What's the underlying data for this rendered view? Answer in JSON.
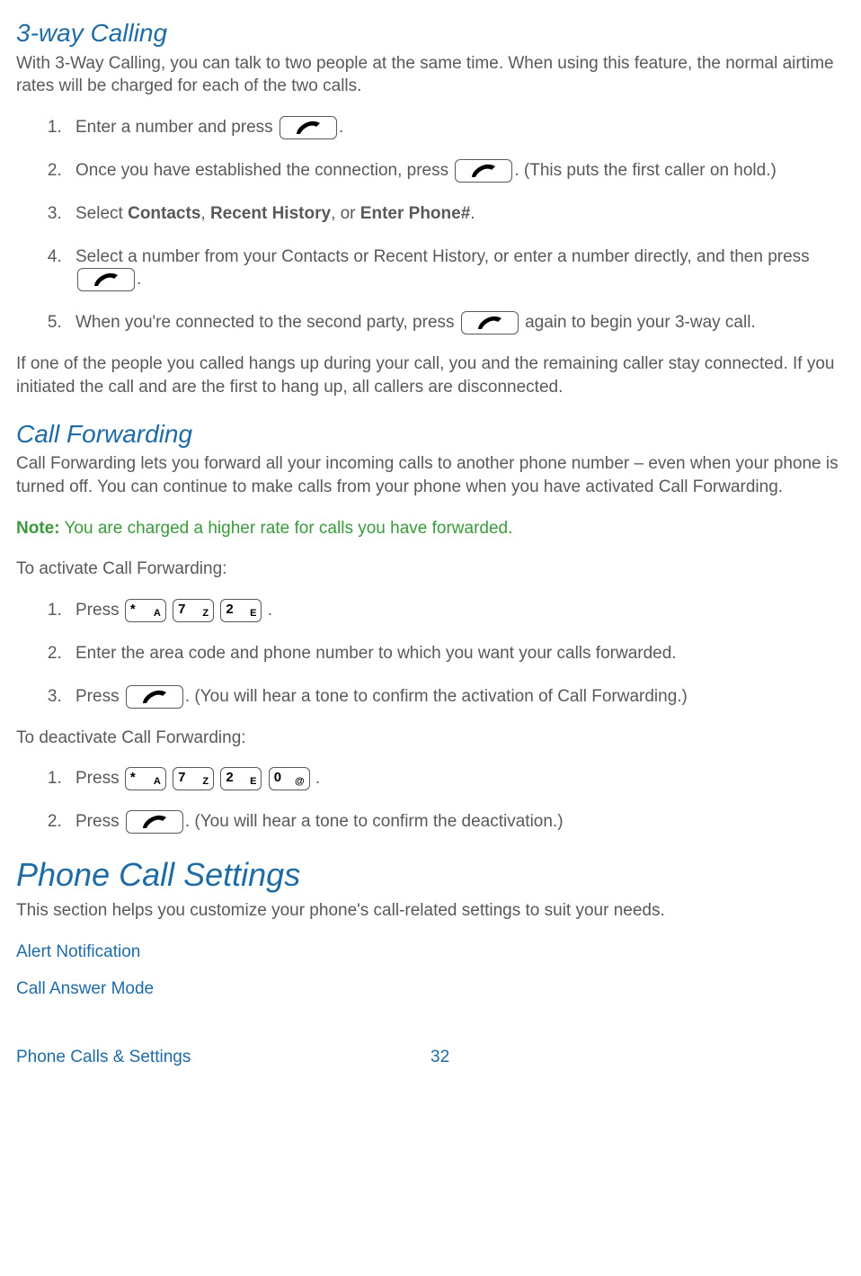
{
  "section1": {
    "title": "3-way Calling",
    "intro": "With 3-Way Calling, you can talk to two people at the same time. When using this feature, the normal airtime rates will be charged for each of the two calls.",
    "step1_a": "Enter a number and press ",
    "step1_b": ".",
    "step2_a": "Once you have established the connection, press ",
    "step2_b": ". (This puts the first caller on hold.)",
    "step3_a": "Select ",
    "step3_contacts": "Contacts",
    "step3_sep1": ", ",
    "step3_recent": "Recent History",
    "step3_sep2": ", or ",
    "step3_enter": "Enter Phone#",
    "step3_end": ".",
    "step4_a": "Select a number from your Contacts or Recent History, or enter a number directly, and then press ",
    "step4_b": ".",
    "step5_a": "When you're connected to the second party, press ",
    "step5_b": " again to begin your 3-way call.",
    "outro": "If one of the people you called hangs up during your call, you and the remaining caller stay connected. If you initiated the call and are the first to hang up, all callers are disconnected."
  },
  "section2": {
    "title": "Call Forwarding",
    "intro": "Call Forwarding lets you forward all your incoming calls to another phone number – even when your phone is turned off. You can continue to make calls from your phone when you have activated Call Forwarding.",
    "note_label": "Note:",
    "note_text": " You are charged a higher rate for calls you have forwarded.",
    "activate_label": "To activate Call Forwarding:",
    "act_step1_a": "Press ",
    "act_step1_b": ".",
    "act_step2": "Enter the area code and phone number to which you want your calls forwarded.",
    "act_step3_a": "Press ",
    "act_step3_b": ". (You will hear a tone to confirm the activation of Call Forwarding.)",
    "deactivate_label": "To deactivate Call Forwarding:",
    "deact_step1_a": "Press ",
    "deact_step1_b": ".",
    "deact_step2_a": "Press ",
    "deact_step2_b": ". (You will hear a tone to confirm the deactivation.)"
  },
  "section3": {
    "title": "Phone Call Settings",
    "intro": "This section helps you customize your phone's call-related settings to suit your needs.",
    "link1": "Alert Notification",
    "link2": "Call Answer Mode"
  },
  "keys": {
    "star_big": "*",
    "star_small": "A",
    "seven_big": "7",
    "seven_small": "Z",
    "two_big": "2",
    "two_small": "E",
    "zero_big": "0",
    "zero_small": "@"
  },
  "footer": {
    "left": "Phone Calls & Settings",
    "page": "32"
  }
}
